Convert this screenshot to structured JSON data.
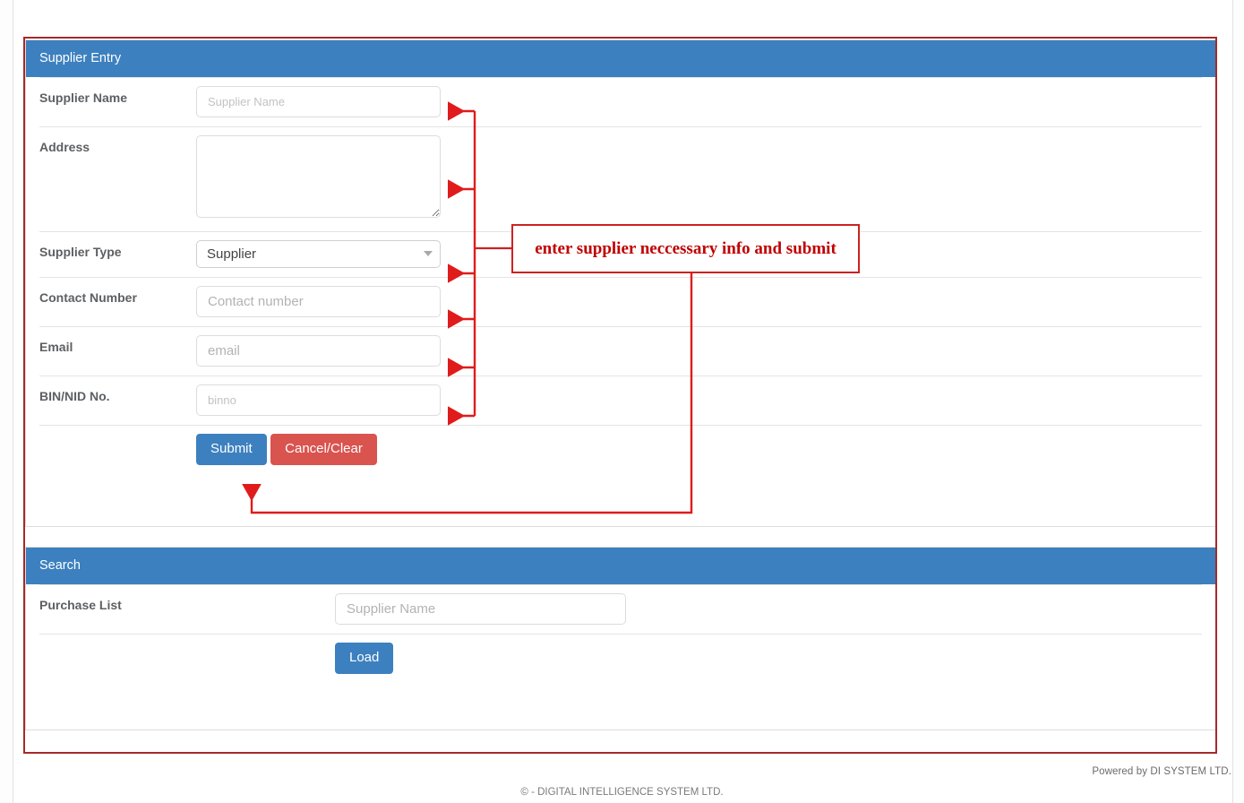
{
  "supplier_entry": {
    "heading": "Supplier Entry",
    "fields": [
      {
        "label": "Supplier Name",
        "placeholder": "Supplier Name",
        "type": "text"
      },
      {
        "label": "Address",
        "placeholder": "",
        "type": "textarea"
      },
      {
        "label": "Supplier Type",
        "value": "Supplier",
        "type": "select",
        "options": [
          "Supplier"
        ]
      },
      {
        "label": "Contact Number",
        "placeholder": "Contact number",
        "type": "text"
      },
      {
        "label": "Email",
        "placeholder": "email",
        "type": "text"
      },
      {
        "label": "BIN/NID No.",
        "placeholder": "binno",
        "type": "text"
      }
    ],
    "submit_label": "Submit",
    "cancel_label": "Cancel/Clear"
  },
  "search": {
    "heading": "Search",
    "label": "Purchase List",
    "placeholder": "Supplier Name",
    "load_label": "Load"
  },
  "annotation": {
    "note": "enter supplier neccessary info and submit",
    "color": "#c00000",
    "frame_color": "#a52a2a"
  },
  "footer": {
    "powered_by": "Powered by DI SYSTEM LTD.",
    "copyright": "©  - DIGITAL INTELLIGENCE SYSTEM LTD."
  },
  "colors": {
    "panel_heading": "#3c80bf",
    "primary_button": "#3c80bf",
    "danger_button": "#d9534f",
    "label_text": "#5d6063"
  }
}
